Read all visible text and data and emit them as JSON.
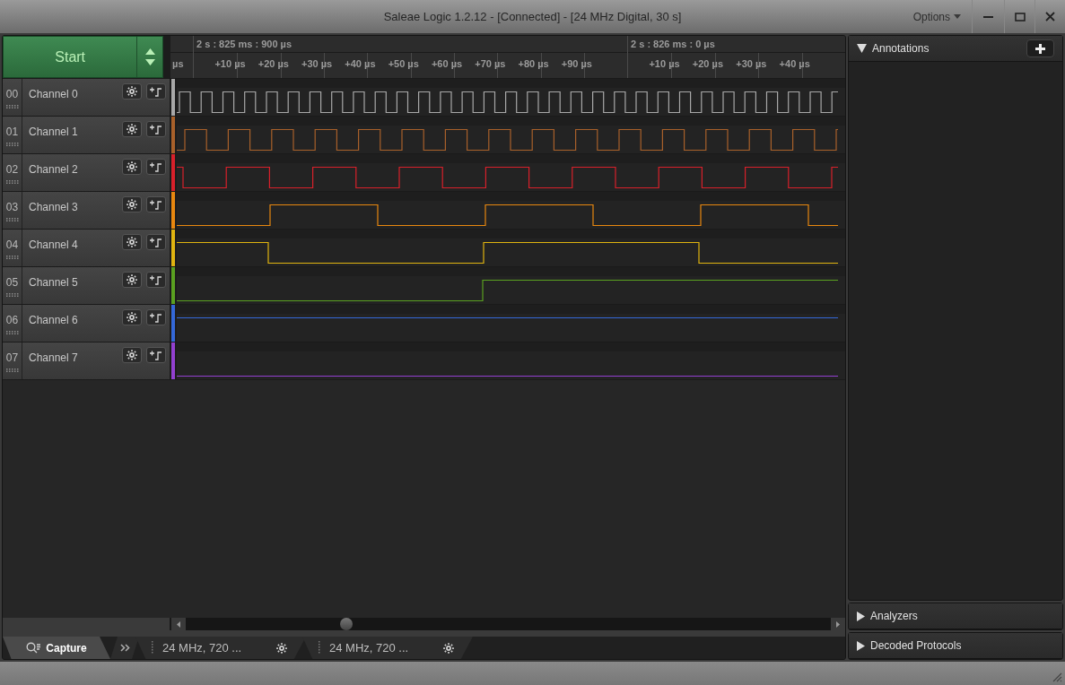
{
  "window": {
    "title": "Saleae Logic 1.2.12 - [Connected] - [24 MHz Digital, 30 s]",
    "options_menu": "Options"
  },
  "start_button": "Start",
  "timeline": {
    "leading_tick": "µs",
    "markers": [
      {
        "label": "2 s : 825 ms : 900 µs",
        "ticks": [
          "+10 µs",
          "+20 µs",
          "+30 µs",
          "+40 µs",
          "+50 µs",
          "+60 µs",
          "+70 µs",
          "+80 µs",
          "+90 µs"
        ]
      },
      {
        "label": "2 s : 826 ms : 0 µs",
        "ticks": [
          "+10 µs",
          "+20 µs",
          "+30 µs",
          "+40 µs"
        ]
      }
    ]
  },
  "channels": [
    {
      "number": "00",
      "name": "Channel 0",
      "color": "#a8a8a8"
    },
    {
      "number": "01",
      "name": "Channel 1",
      "color": "#a8602a"
    },
    {
      "number": "02",
      "name": "Channel 2",
      "color": "#d8202a"
    },
    {
      "number": "03",
      "name": "Channel 3",
      "color": "#e8870f"
    },
    {
      "number": "04",
      "name": "Channel 4",
      "color": "#e0b410"
    },
    {
      "number": "05",
      "name": "Channel 5",
      "color": "#5aa020"
    },
    {
      "number": "06",
      "name": "Channel 6",
      "color": "#3468d8"
    },
    {
      "number": "07",
      "name": "Channel 7",
      "color": "#9240d0"
    }
  ],
  "tabs": [
    {
      "kind": "capture",
      "label": "Capture",
      "selected": true
    },
    {
      "kind": "session",
      "label": "24 MHz, 720 ...",
      "selected": false
    },
    {
      "kind": "session",
      "label": "24 MHz, 720 ...",
      "selected": false
    }
  ],
  "side_panels": [
    {
      "title": "Annotations",
      "expanded": true,
      "addable": true
    },
    {
      "title": "Analyzers",
      "expanded": false,
      "addable": false
    },
    {
      "title": "Decoded Protocols",
      "expanded": false,
      "addable": false
    }
  ]
}
